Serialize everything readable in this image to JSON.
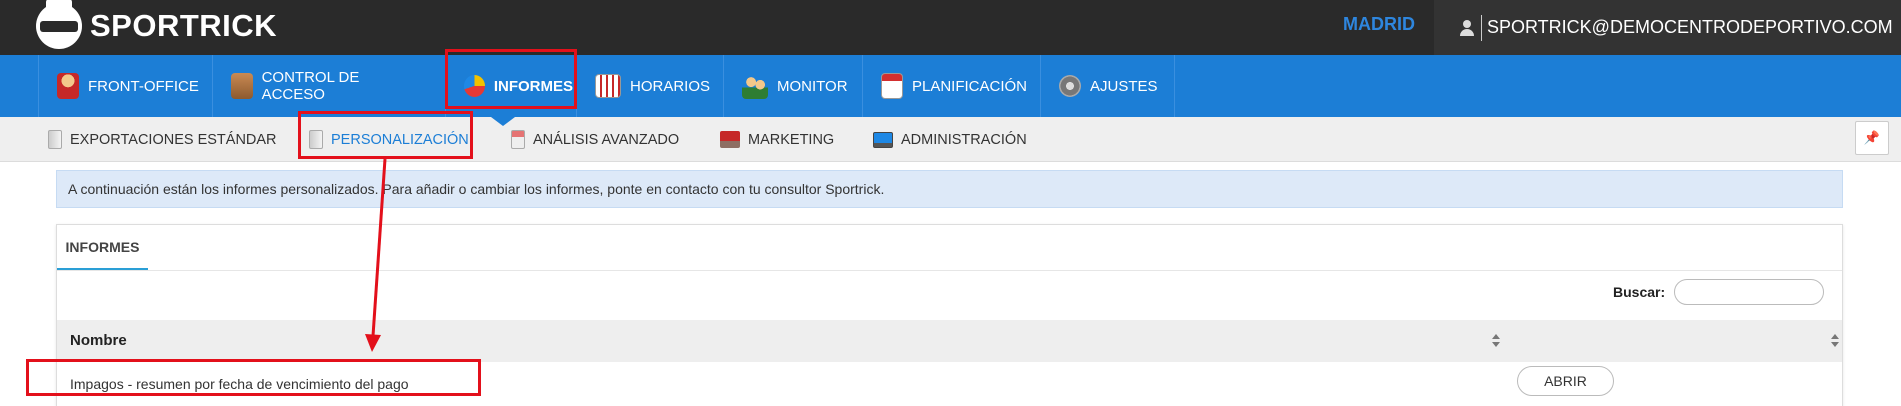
{
  "app": {
    "brand": "SPORTRICK",
    "location": "MADRID",
    "user_email": "SPORTRICK@DEMOCENTRODEPORTIVO.COM"
  },
  "main_nav": [
    {
      "label": "FRONT-OFFICE",
      "icon": "user-receptionist-icon",
      "active": false
    },
    {
      "label": "CONTROL DE ACCESO",
      "icon": "access-control-icon",
      "active": false
    },
    {
      "label": "INFORMES",
      "icon": "pie-chart-icon",
      "active": true
    },
    {
      "label": "HORARIOS",
      "icon": "calendar-grid-icon",
      "active": false
    },
    {
      "label": "MONITOR",
      "icon": "people-icon",
      "active": false
    },
    {
      "label": "PLANIFICACIÓN",
      "icon": "calendar-icon",
      "active": false
    },
    {
      "label": "AJUSTES",
      "icon": "gear-icon",
      "active": false
    }
  ],
  "sub_nav": [
    {
      "label": "EXPORTACIONES ESTÁNDAR",
      "icon": "document-icon",
      "active": false
    },
    {
      "label": "PERSONALIZACIÓN",
      "icon": "document-icon",
      "active": true
    },
    {
      "label": "ANÁLISIS AVANZADO",
      "icon": "report-icon",
      "active": false
    },
    {
      "label": "MARKETING",
      "icon": "marketing-icon",
      "active": false
    },
    {
      "label": "ADMINISTRACIÓN",
      "icon": "monitor-icon",
      "active": false
    }
  ],
  "pin_symbol": "📌",
  "info_message": "A continuación están los informes personalizados. Para añadir o cambiar los informes, ponte en contacto con tu consultor Sportrick.",
  "panel": {
    "tab_label": "INFORMES",
    "search_label": "Buscar:",
    "search_value": "",
    "columns": [
      "Nombre",
      ""
    ],
    "rows": [
      {
        "name": "Impagos - resumen por fecha de vencimiento del pago",
        "action": "ABRIR"
      }
    ]
  },
  "colors": {
    "topbar": "#2a2a2a",
    "nav_blue": "#1c7ed6",
    "annotation_red": "#e3101b"
  }
}
